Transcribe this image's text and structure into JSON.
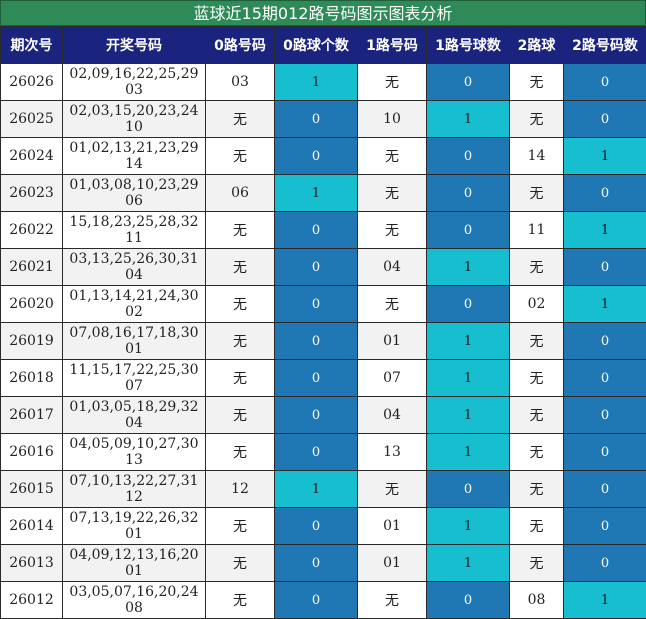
{
  "title": "蓝球近15期012路号码图示图表分析",
  "headers": [
    "期次号",
    "开奖号码",
    "0路号码",
    "0路球个数",
    "1路号码",
    "1路号球数",
    "2路球",
    "2路号码数"
  ],
  "rows": [
    {
      "issue": "26026",
      "numbers": "02,09,16,22,25,29 03",
      "r0": "03",
      "c0": "1",
      "r1": "无",
      "c1": "0",
      "r2": "无",
      "c2": "0"
    },
    {
      "issue": "26025",
      "numbers": "02,03,15,20,23,24 10",
      "r0": "无",
      "c0": "0",
      "r1": "10",
      "c1": "1",
      "r2": "无",
      "c2": "0"
    },
    {
      "issue": "26024",
      "numbers": "01,02,13,21,23,29 14",
      "r0": "无",
      "c0": "0",
      "r1": "无",
      "c1": "0",
      "r2": "14",
      "c2": "1"
    },
    {
      "issue": "26023",
      "numbers": "01,03,08,10,23,29 06",
      "r0": "06",
      "c0": "1",
      "r1": "无",
      "c1": "0",
      "r2": "无",
      "c2": "0"
    },
    {
      "issue": "26022",
      "numbers": "15,18,23,25,28,32 11",
      "r0": "无",
      "c0": "0",
      "r1": "无",
      "c1": "0",
      "r2": "11",
      "c2": "1"
    },
    {
      "issue": "26021",
      "numbers": "03,13,25,26,30,31 04",
      "r0": "无",
      "c0": "0",
      "r1": "04",
      "c1": "1",
      "r2": "无",
      "c2": "0"
    },
    {
      "issue": "26020",
      "numbers": "01,13,14,21,24,30 02",
      "r0": "无",
      "c0": "0",
      "r1": "无",
      "c1": "0",
      "r2": "02",
      "c2": "1"
    },
    {
      "issue": "26019",
      "numbers": "07,08,16,17,18,30 01",
      "r0": "无",
      "c0": "0",
      "r1": "01",
      "c1": "1",
      "r2": "无",
      "c2": "0"
    },
    {
      "issue": "26018",
      "numbers": "11,15,17,22,25,30 07",
      "r0": "无",
      "c0": "0",
      "r1": "07",
      "c1": "1",
      "r2": "无",
      "c2": "0"
    },
    {
      "issue": "26017",
      "numbers": "01,03,05,18,29,32 04",
      "r0": "无",
      "c0": "0",
      "r1": "04",
      "c1": "1",
      "r2": "无",
      "c2": "0"
    },
    {
      "issue": "26016",
      "numbers": "04,05,09,10,27,30 13",
      "r0": "无",
      "c0": "0",
      "r1": "13",
      "c1": "1",
      "r2": "无",
      "c2": "0"
    },
    {
      "issue": "26015",
      "numbers": "07,10,13,22,27,31 12",
      "r0": "12",
      "c0": "1",
      "r1": "无",
      "c1": "0",
      "r2": "无",
      "c2": "0"
    },
    {
      "issue": "26014",
      "numbers": "07,13,19,22,26,32 01",
      "r0": "无",
      "c0": "0",
      "r1": "01",
      "c1": "1",
      "r2": "无",
      "c2": "0"
    },
    {
      "issue": "26013",
      "numbers": "04,09,12,13,16,20 01",
      "r0": "无",
      "c0": "0",
      "r1": "01",
      "c1": "1",
      "r2": "无",
      "c2": "0"
    },
    {
      "issue": "26012",
      "numbers": "03,05,07,16,20,24 08",
      "r0": "无",
      "c0": "0",
      "r1": "无",
      "c1": "0",
      "r2": "08",
      "c2": "1"
    }
  ],
  "colors": {
    "title_bg": "#2e8b57",
    "header_bg": "#1a237e",
    "count_zero": "#1f77b4",
    "count_one": "#17becf"
  }
}
